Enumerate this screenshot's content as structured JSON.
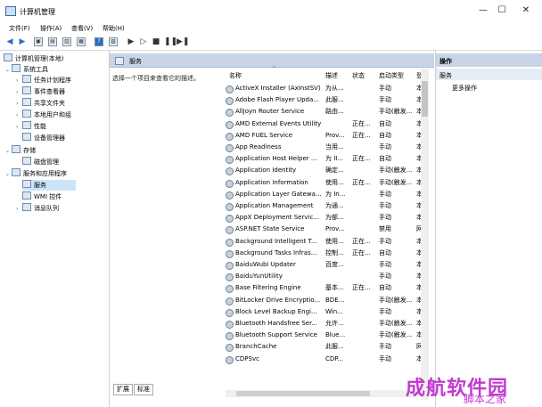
{
  "window": {
    "title": "计算机管理",
    "controls": [
      "—",
      "☐",
      "✕"
    ]
  },
  "menu": [
    "文件(F)",
    "操作(A)",
    "查看(V)",
    "帮助(H)"
  ],
  "tree": {
    "root": "计算机管理(本地)",
    "system_tools": "系统工具",
    "task_scheduler": "任务计划程序",
    "event_viewer": "事件查看器",
    "shared_folders": "共享文件夹",
    "local_users": "本地用户和组",
    "performance": "性能",
    "device_manager": "设备管理器",
    "storage": "存储",
    "disk_management": "磁盘管理",
    "services_apps": "服务和应用程序",
    "services": "服务",
    "wmi": "WMI 控件",
    "message_queue": "消息队列"
  },
  "center": {
    "header": "服务",
    "description": "选择一个项目来查看它的描述。",
    "columns": [
      "名称",
      "描述",
      "状态",
      "启动类型",
      "登"
    ],
    "rows": [
      [
        "ActiveX Installer (AxInstSV)",
        "为从...",
        "",
        "手动",
        "本"
      ],
      [
        "Adobe Flash Player Upda...",
        "此服...",
        "",
        "手动",
        "本"
      ],
      [
        "AllJoyn Router Service",
        "路由...",
        "",
        "手动(触发...",
        "本"
      ],
      [
        "AMD External Events Utility",
        "",
        "正在...",
        "自动",
        "本"
      ],
      [
        "AMD FUEL Service",
        "Prov...",
        "正在...",
        "自动",
        "本"
      ],
      [
        "App Readiness",
        "当用...",
        "",
        "手动",
        "本"
      ],
      [
        "Application Host Helper ...",
        "为 II...",
        "正在...",
        "自动",
        "本"
      ],
      [
        "Application Identity",
        "确定...",
        "",
        "手动(触发...",
        "本"
      ],
      [
        "Application Information",
        "使用...",
        "正在...",
        "手动(触发...",
        "本"
      ],
      [
        "Application Layer Gatewa...",
        "为 In...",
        "",
        "手动",
        "本"
      ],
      [
        "Application Management",
        "为通...",
        "",
        "手动",
        "本"
      ],
      [
        "AppX Deployment Servic...",
        "为部...",
        "",
        "手动",
        "本"
      ],
      [
        "ASP.NET State Service",
        "Prov...",
        "",
        "禁用",
        "网"
      ],
      [
        "Background Intelligent T...",
        "使用...",
        "正在...",
        "手动",
        "本"
      ],
      [
        "Background Tasks Infras...",
        "控制...",
        "正在...",
        "自动",
        "本"
      ],
      [
        "BaiduWubi Updater",
        "百度...",
        "",
        "手动",
        "本"
      ],
      [
        "BaiduYunUtility",
        "",
        "",
        "手动",
        "本"
      ],
      [
        "Base Filtering Engine",
        "基本...",
        "正在...",
        "自动",
        "本"
      ],
      [
        "BitLocker Drive Encryptio...",
        "BDE...",
        "",
        "手动(触发...",
        "本"
      ],
      [
        "Block Level Backup Engi...",
        "Win...",
        "",
        "手动",
        "本"
      ],
      [
        "Bluetooth Handsfree Ser...",
        "允许...",
        "",
        "手动(触发...",
        "本"
      ],
      [
        "Bluetooth Support Service",
        "Blue...",
        "",
        "手动(触发...",
        "本"
      ],
      [
        "BranchCache",
        "此服...",
        "",
        "手动",
        "网"
      ],
      [
        "CDPSvc",
        "CDP...",
        "",
        "手动",
        "本"
      ]
    ],
    "tabs": [
      "扩展",
      "标准"
    ]
  },
  "actions": {
    "title": "操作",
    "section": "服务",
    "more": "更多操作"
  },
  "watermark": {
    "main": "成航软件园",
    "sub": "脚本之家"
  }
}
